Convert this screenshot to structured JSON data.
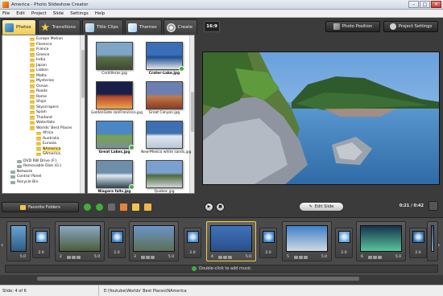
{
  "window": {
    "title": "America - Photo Slideshow Creator"
  },
  "menu": [
    "File",
    "Edit",
    "Project",
    "Slide",
    "Settings",
    "Help"
  ],
  "tabs": [
    {
      "label": "Photos",
      "active": true
    },
    {
      "label": "Transitions",
      "active": false
    },
    {
      "label": "Title Clips",
      "active": false
    },
    {
      "label": "Themes",
      "active": false
    },
    {
      "label": "Create",
      "active": false
    }
  ],
  "folder_tree": {
    "items": [
      {
        "label": "Europe Motion",
        "indent": 3,
        "type": "folder"
      },
      {
        "label": "Florence",
        "indent": 3,
        "type": "folder"
      },
      {
        "label": "France",
        "indent": 3,
        "type": "folder"
      },
      {
        "label": "Greece",
        "indent": 3,
        "type": "folder"
      },
      {
        "label": "India",
        "indent": 3,
        "type": "folder"
      },
      {
        "label": "Japan",
        "indent": 3,
        "type": "folder"
      },
      {
        "label": "Lisbon",
        "indent": 3,
        "type": "folder"
      },
      {
        "label": "Malta",
        "indent": 3,
        "type": "folder"
      },
      {
        "label": "Mysteries",
        "indent": 3,
        "type": "folder"
      },
      {
        "label": "Ocean",
        "indent": 3,
        "type": "folder"
      },
      {
        "label": "Roads",
        "indent": 3,
        "type": "folder"
      },
      {
        "label": "Rome",
        "indent": 3,
        "type": "folder"
      },
      {
        "label": "Ships",
        "indent": 3,
        "type": "folder"
      },
      {
        "label": "Skyscrapers",
        "indent": 3,
        "type": "folder"
      },
      {
        "label": "Spain",
        "indent": 3,
        "type": "folder"
      },
      {
        "label": "Thailand",
        "indent": 3,
        "type": "folder"
      },
      {
        "label": "Waterfalls",
        "indent": 3,
        "type": "folder"
      },
      {
        "label": "Worlds' Best Places",
        "indent": 3,
        "type": "folder"
      },
      {
        "label": "Africa",
        "indent": 4,
        "type": "folder"
      },
      {
        "label": "Australia",
        "indent": 4,
        "type": "folder"
      },
      {
        "label": "Eurasia",
        "indent": 4,
        "type": "folder"
      },
      {
        "label": "NAmerica",
        "indent": 4,
        "type": "folder",
        "selected": true
      },
      {
        "label": "SAmerica",
        "indent": 4,
        "type": "folder"
      },
      {
        "label": "DVD RW Drive (F:)",
        "indent": 1,
        "type": "drive"
      },
      {
        "label": "Removable Disk (G:)",
        "indent": 1,
        "type": "drive"
      },
      {
        "label": "Network",
        "indent": 0,
        "type": "drive"
      },
      {
        "label": "Control Panel",
        "indent": 0,
        "type": "drive"
      },
      {
        "label": "Recycle Bin",
        "indent": 0,
        "type": "drive"
      }
    ]
  },
  "photos": [
    {
      "name": "Cordilleras.jpg",
      "bold": false,
      "checked": false,
      "colors": [
        "#7fa6c9",
        "#5b6f4f",
        "#3f4a2e"
      ]
    },
    {
      "name": "Crater-Lake.jpg",
      "bold": true,
      "checked": true,
      "colors": [
        "#3a6fb7",
        "#1f4f93",
        "#e4e7ea"
      ]
    },
    {
      "name": "GoldenGate sanFrancisco.jpg",
      "bold": false,
      "checked": false,
      "colors": [
        "#1a1f4a",
        "#b6482c",
        "#f0a34c"
      ]
    },
    {
      "name": "Great Canyon.jpg",
      "bold": false,
      "checked": false,
      "colors": [
        "#6b7fb1",
        "#c1794b",
        "#8a3d24"
      ]
    },
    {
      "name": "Great Lakes.jpg",
      "bold": true,
      "checked": true,
      "colors": [
        "#4a87c4",
        "#78a24f",
        "#7a8f95"
      ]
    },
    {
      "name": "New-Mexico white sands.jpg",
      "bold": false,
      "checked": false,
      "colors": [
        "#3e6fb1",
        "#dfe8f1",
        "#b9c7d6"
      ]
    },
    {
      "name": "Niagara falls.jpg",
      "bold": true,
      "checked": true,
      "colors": [
        "#6d8fa9",
        "#dfe9ef",
        "#334a5a"
      ]
    },
    {
      "name": "Quebec.jpg",
      "bold": false,
      "checked": false,
      "colors": [
        "#7aa0cf",
        "#4f6a3a",
        "#cfd7db"
      ]
    }
  ],
  "left_toolbar": {
    "favorite_label": "Favorite Folders"
  },
  "preview_header": {
    "ratio": "16:9",
    "photo_position": "Photo Position",
    "project_settings": "Project Settings"
  },
  "player": {
    "edit_label": "Edit Slide",
    "timecode": "0:21 / 0:42"
  },
  "timeline": {
    "slides": [
      {
        "num": "",
        "duration": "5.0",
        "selected": false,
        "colors": [
          "#6aa3d3",
          "#2d5d80"
        ]
      },
      {
        "num": "2",
        "duration": "5.0",
        "selected": false,
        "colors": [
          "#8aa9c4",
          "#4a5d3b"
        ]
      },
      {
        "num": "3",
        "duration": "5.0",
        "selected": false,
        "colors": [
          "#6b94c7",
          "#5c6f56"
        ]
      },
      {
        "num": "4",
        "duration": "5.0",
        "selected": true,
        "colors": [
          "#3f73b9",
          "#2a4f8b"
        ]
      },
      {
        "num": "5",
        "duration": "5.0",
        "selected": false,
        "colors": [
          "#3e80c9",
          "#cfd8e1"
        ]
      },
      {
        "num": "6",
        "duration": "5.0",
        "selected": false,
        "colors": [
          "#16324d",
          "#57c49a"
        ]
      },
      {
        "num": "",
        "duration": "5.0",
        "selected": false,
        "colors": [
          "#33557a",
          "#7aa3c8"
        ]
      }
    ],
    "transitions": [
      "2.0",
      "2.0",
      "2.0",
      "2.0",
      "2.0",
      "2.0",
      "2.0"
    ],
    "music_hint": "Double-click to add music"
  },
  "status": {
    "slide": "Slide: 4 of 6",
    "path": "E:\\Youtube\\Worlds' Best Places\\NAmerica"
  },
  "icons": {
    "photos_tab": "photo-icon",
    "transitions_tab": "star-icon",
    "title_clips_tab": "film-icon",
    "themes_tab": "palette-icon",
    "create_tab": "film-reel-icon"
  },
  "colors": {
    "accent": "#f2c94c",
    "dark_bg": "#3b3b3b",
    "check": "#3fae3a"
  }
}
